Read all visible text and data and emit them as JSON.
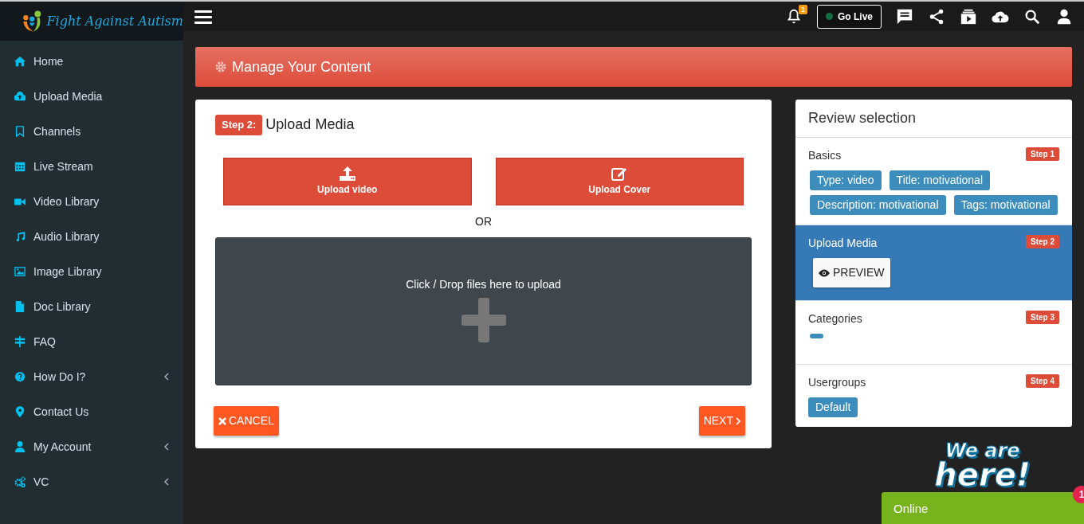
{
  "brand": {
    "name": "Fight Against Autism"
  },
  "topbar": {
    "notification_count": "1",
    "go_live": {
      "label": "Go Live",
      "live": false
    }
  },
  "sidebar": {
    "items": [
      {
        "label": "Home",
        "has_submenu": false
      },
      {
        "label": "Upload Media",
        "has_submenu": false
      },
      {
        "label": "Channels",
        "has_submenu": false
      },
      {
        "label": "Live Stream",
        "has_submenu": false
      },
      {
        "label": "Video Library",
        "has_submenu": false
      },
      {
        "label": "Audio Library",
        "has_submenu": false
      },
      {
        "label": "Image Library",
        "has_submenu": false
      },
      {
        "label": "Doc Library",
        "has_submenu": false
      },
      {
        "label": "FAQ",
        "has_submenu": false
      },
      {
        "label": "How Do I?",
        "has_submenu": true
      },
      {
        "label": "Contact Us",
        "has_submenu": false
      },
      {
        "label": "My Account",
        "has_submenu": true
      },
      {
        "label": "VC",
        "has_submenu": true
      }
    ]
  },
  "page_header": {
    "title": "Manage Your Content"
  },
  "upload": {
    "step_badge": "Step 2:",
    "title": "Upload Media",
    "buttons": [
      {
        "label": "Upload video"
      },
      {
        "label": "Upload Cover"
      }
    ],
    "separator": "OR",
    "dropzone": {
      "text": "Click / Drop files here to upload"
    },
    "cancel": "CANCEL",
    "next": "NEXT"
  },
  "review": {
    "title": "Review selection",
    "sections": [
      {
        "title": "Basics",
        "step": "Step 1",
        "selected": false,
        "tags": [
          "Type: video",
          "Title: motivational",
          "Description: motivational",
          "Tags: motivational"
        ]
      },
      {
        "title": "Upload Media",
        "step": "Step 2",
        "selected": true,
        "preview_button": "PREVIEW"
      },
      {
        "title": "Categories",
        "step": "Step 3",
        "selected": false,
        "blank_tag": true
      },
      {
        "title": "Usergroups",
        "step": "Step 4",
        "selected": false,
        "tags": [
          "Default"
        ]
      }
    ]
  },
  "chat": {
    "banner": "We are here!",
    "status": "Online",
    "unread": "1"
  }
}
